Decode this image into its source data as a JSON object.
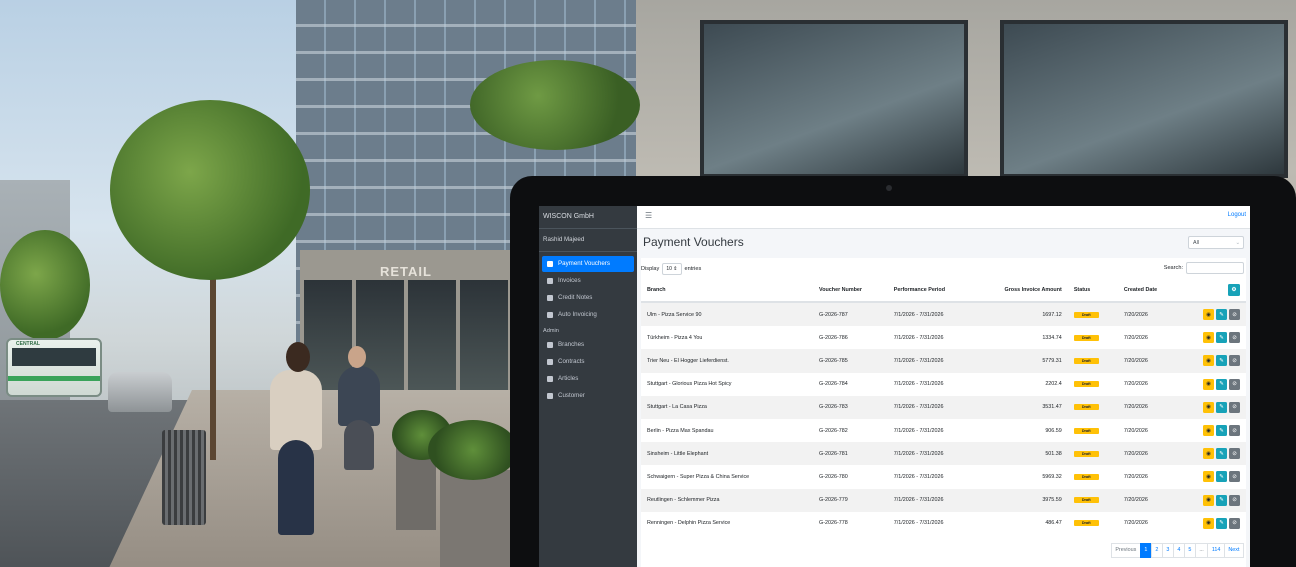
{
  "app": {
    "brand": "WISCON GmbH",
    "user_name": "Rashid Majeed",
    "logout_label": "Logout"
  },
  "sidebar": {
    "items": [
      {
        "label": "Payment Vouchers",
        "icon": "file-icon",
        "active": true
      },
      {
        "label": "Invoices",
        "icon": "edit-icon"
      },
      {
        "label": "Credit Notes",
        "icon": "document-icon"
      },
      {
        "label": "Auto Invoicing",
        "icon": "invoice-icon"
      }
    ],
    "admin_header": "Admin",
    "admin_items": [
      {
        "label": "Branches",
        "icon": "store-icon"
      },
      {
        "label": "Contracts",
        "icon": "contract-icon"
      },
      {
        "label": "Articles",
        "icon": "layers-icon"
      },
      {
        "label": "Customer",
        "icon": "user-icon"
      }
    ]
  },
  "page": {
    "title": "Payment Vouchers",
    "filter_value": "All"
  },
  "table_controls": {
    "display_label": "Display",
    "display_value": "10",
    "entries_label": "entries",
    "search_label": "Search:",
    "search_value": ""
  },
  "table": {
    "headers": [
      "Branch",
      "Voucher Number",
      "Performance Period",
      "Gross Invoice Amount",
      "Status",
      "Created Date"
    ],
    "rows": [
      {
        "branch": "Ulm - Pizza Service 90",
        "voucher": "G-2026-787",
        "period": "7/1/2026 - 7/31/2026",
        "amount": "1697.12",
        "status": "Draft",
        "created": "7/20/2026"
      },
      {
        "branch": "Türkheim - Pizza 4 You",
        "voucher": "G-2026-786",
        "period": "7/1/2026 - 7/31/2026",
        "amount": "1334.74",
        "status": "Draft",
        "created": "7/20/2026"
      },
      {
        "branch": "Trier Neu - El Hogger Lieferdienst.",
        "voucher": "G-2026-785",
        "period": "7/1/2026 - 7/31/2026",
        "amount": "5779.31",
        "status": "Draft",
        "created": "7/20/2026"
      },
      {
        "branch": "Stuttgart - Glorious Pizza Hot Spicy",
        "voucher": "G-2026-784",
        "period": "7/1/2026 - 7/31/2026",
        "amount": "2202.4",
        "status": "Draft",
        "created": "7/20/2026"
      },
      {
        "branch": "Stuttgart - La Casa Pizza",
        "voucher": "G-2026-783",
        "period": "7/1/2026 - 7/31/2026",
        "amount": "3531.47",
        "status": "Draft",
        "created": "7/20/2026"
      },
      {
        "branch": "Berlin - Pizza Max Spandau",
        "voucher": "G-2026-782",
        "period": "7/1/2026 - 7/31/2026",
        "amount": "906.59",
        "status": "Draft",
        "created": "7/20/2026"
      },
      {
        "branch": "Sinsheim - Little Elephant",
        "voucher": "G-2026-781",
        "period": "7/1/2026 - 7/31/2026",
        "amount": "501.38",
        "status": "Draft",
        "created": "7/20/2026"
      },
      {
        "branch": "Schwaigern - Super Pizza & China Service",
        "voucher": "G-2026-780",
        "period": "7/1/2026 - 7/31/2026",
        "amount": "5969.32",
        "status": "Draft",
        "created": "7/20/2026"
      },
      {
        "branch": "Reutlingen - Schlemmer Pizza",
        "voucher": "G-2026-779",
        "period": "7/1/2026 - 7/31/2026",
        "amount": "3975.59",
        "status": "Draft",
        "created": "7/20/2026"
      },
      {
        "branch": "Renningen - Delphin Pizza Service",
        "voucher": "G-2026-778",
        "period": "7/1/2026 - 7/31/2026",
        "amount": "486.47",
        "status": "Draft",
        "created": "7/20/2026"
      }
    ]
  },
  "pagination": {
    "previous": "Previous",
    "pages": [
      "1",
      "2",
      "3",
      "4",
      "5",
      "...",
      "114"
    ],
    "current": "1",
    "next": "Next"
  },
  "colors": {
    "sidebar_bg": "#343a40",
    "primary": "#007bff",
    "status_draft": "#ffc107",
    "edit_button": "#17a2b8",
    "disable_button": "#6c757d"
  },
  "scene": {
    "storefront_sign": "RETAIL",
    "bus_sign": "CENTRAL"
  }
}
